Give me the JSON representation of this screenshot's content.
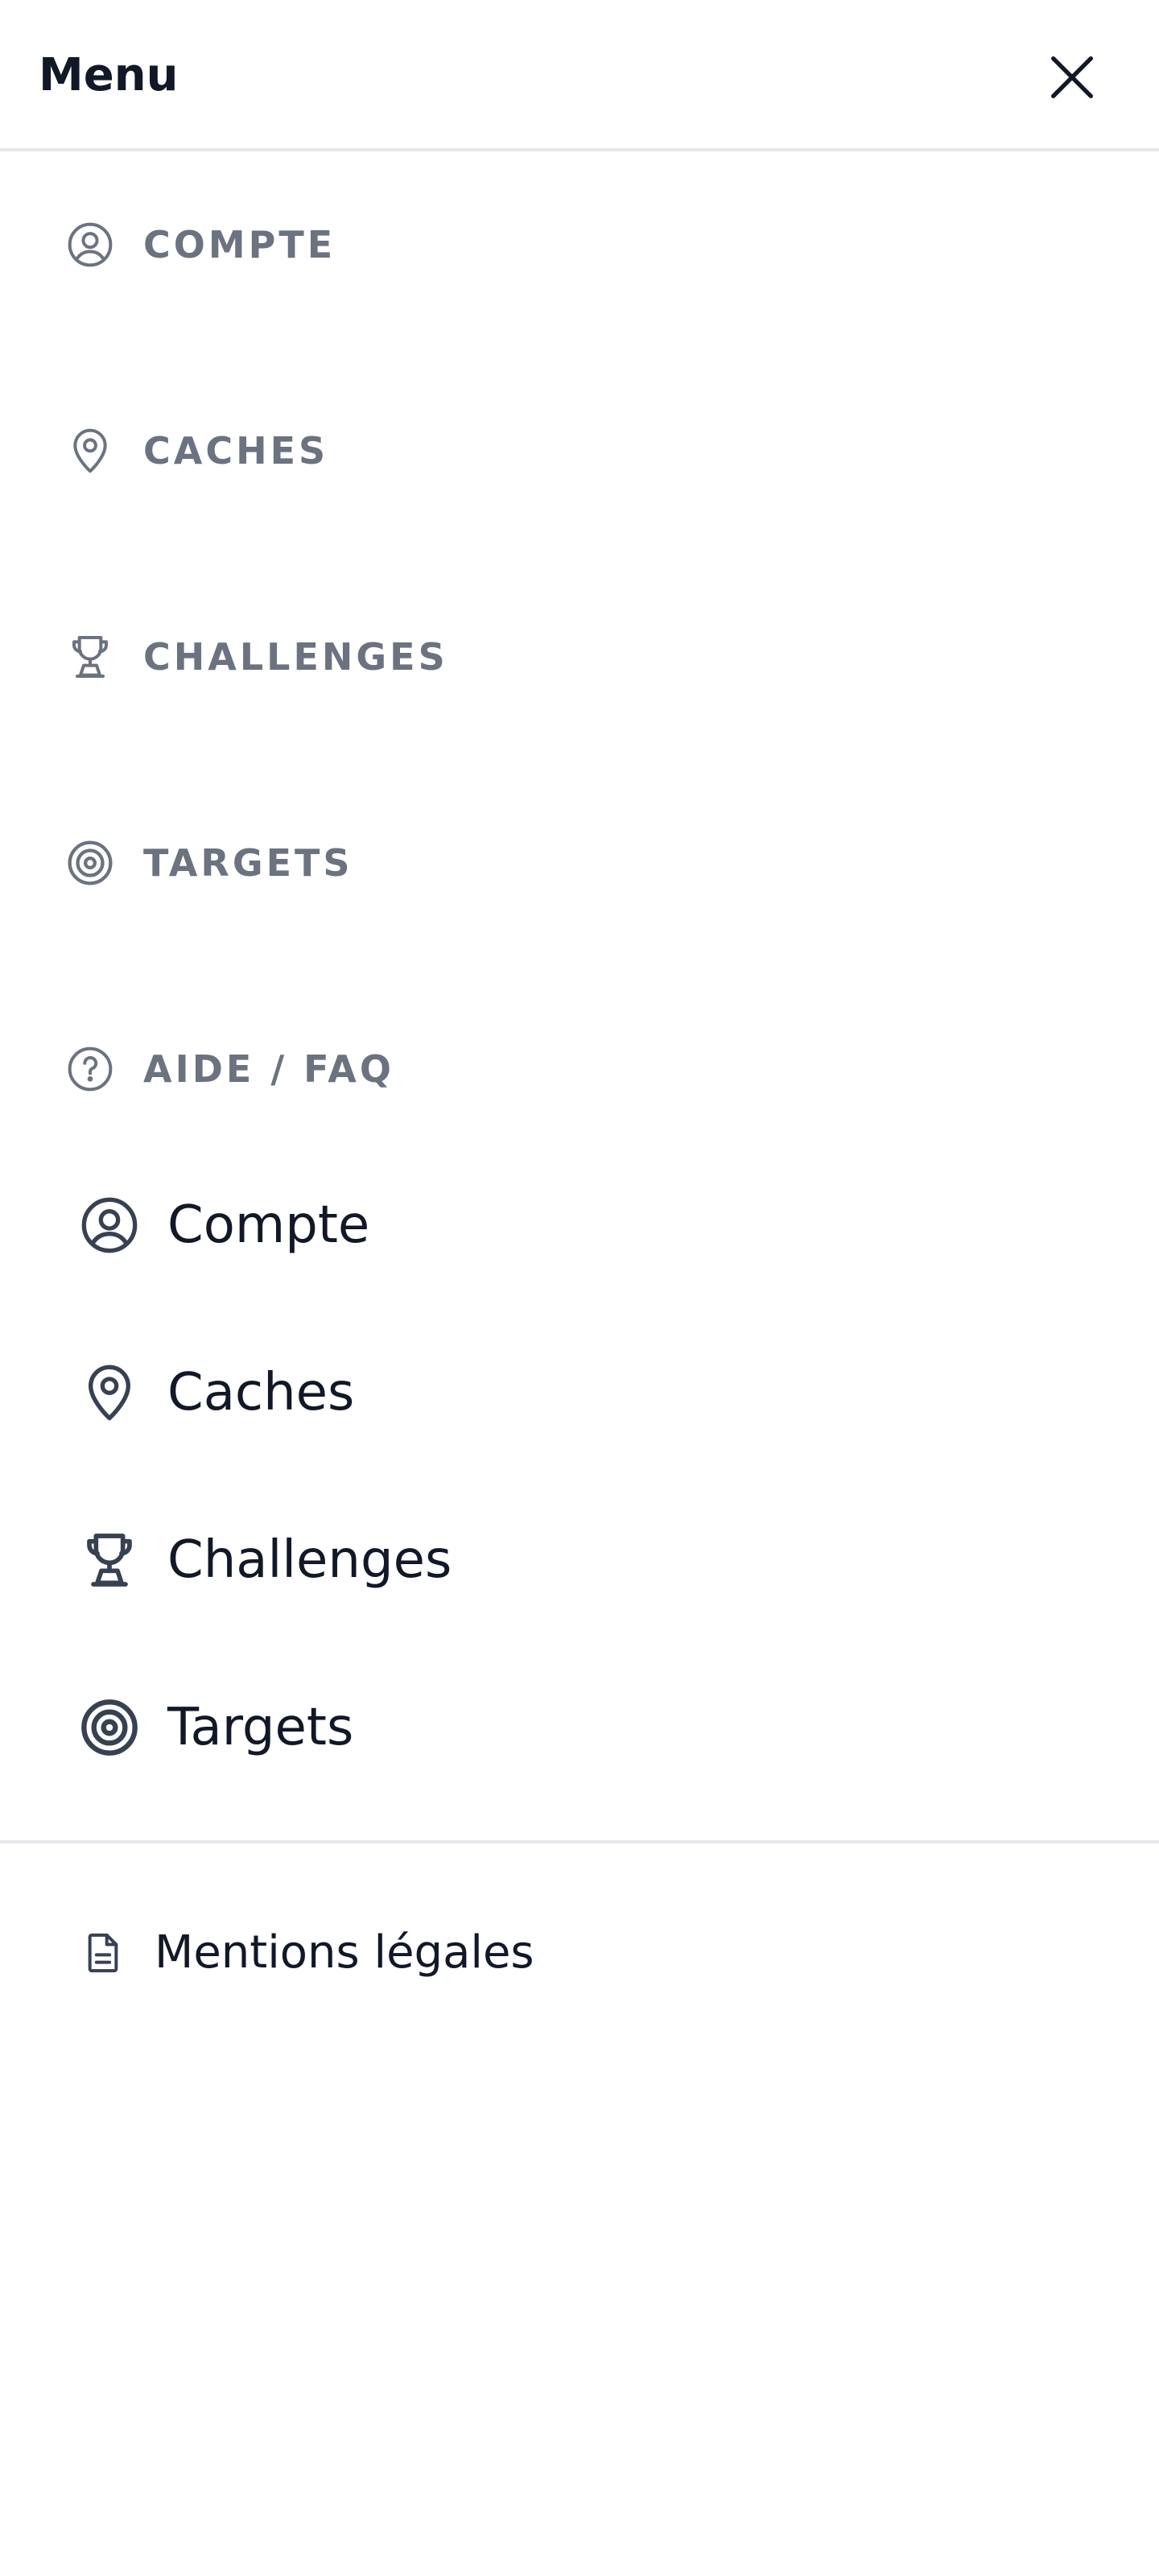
{
  "header": {
    "title": "Menu",
    "close_icon": "close-icon"
  },
  "sections": [
    {
      "label": "COMPTE",
      "icon": "user-circle-icon"
    },
    {
      "label": "CACHES",
      "icon": "map-pin-icon"
    },
    {
      "label": "CHALLENGES",
      "icon": "trophy-icon"
    },
    {
      "label": "TARGETS",
      "icon": "target-icon"
    },
    {
      "label": "AIDE / FAQ",
      "icon": "help-circle-icon"
    }
  ],
  "nav": [
    {
      "label": "Compte",
      "icon": "user-circle-icon"
    },
    {
      "label": "Caches",
      "icon": "map-pin-icon"
    },
    {
      "label": "Challenges",
      "icon": "trophy-icon"
    },
    {
      "label": "Targets",
      "icon": "target-icon"
    }
  ],
  "footer": {
    "legal_label": "Mentions légales",
    "legal_icon": "document-icon"
  },
  "colors": {
    "section_text": "#6b7280",
    "primary_text": "#111827",
    "icon_dark": "#374151",
    "divider": "#e5e7eb"
  }
}
